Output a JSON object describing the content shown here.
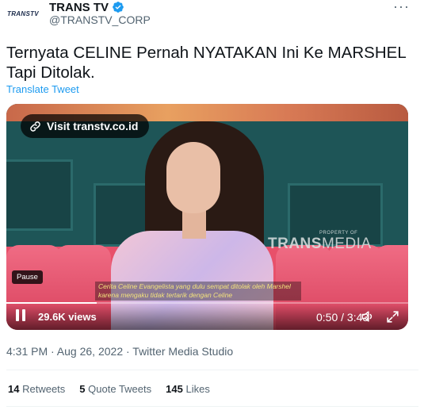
{
  "account": {
    "avatar_text": "TRANSTV",
    "display_name": "TRANS TV",
    "handle": "@TRANSTV_CORP",
    "verified_icon": "verified-badge-icon",
    "more_icon": "more-options-icon",
    "more_label": "···"
  },
  "tweet": {
    "text": "Ternyata CELINE Pernah NYATAKAN Ini Ke MARSHEL Tapi Ditolak.",
    "translate_label": "Translate Tweet"
  },
  "video": {
    "visit_label": "Visit transtv.co.id",
    "watermark_prefix": "PROPERTY OF",
    "watermark_bold": "TRANS",
    "watermark_light": "MEDIA",
    "tooltip": "Pause",
    "subtitle": "Cerita Celine Evangelista yang dulu sempat ditolak oleh Marshel karena mengaku tidak tertarik dengan Celine",
    "views": "29.6K views",
    "timecode": "0:50 / 3:43",
    "progress_fraction": 0.224,
    "accent_color": "#1d9bf0"
  },
  "meta": {
    "text": "4:31 PM · Aug 26, 2022 · Twitter Media Studio"
  },
  "stats": {
    "retweets_count": "14",
    "retweets_label": "Retweets",
    "quotes_count": "5",
    "quotes_label": "Quote Tweets",
    "likes_count": "145",
    "likes_label": "Likes"
  }
}
